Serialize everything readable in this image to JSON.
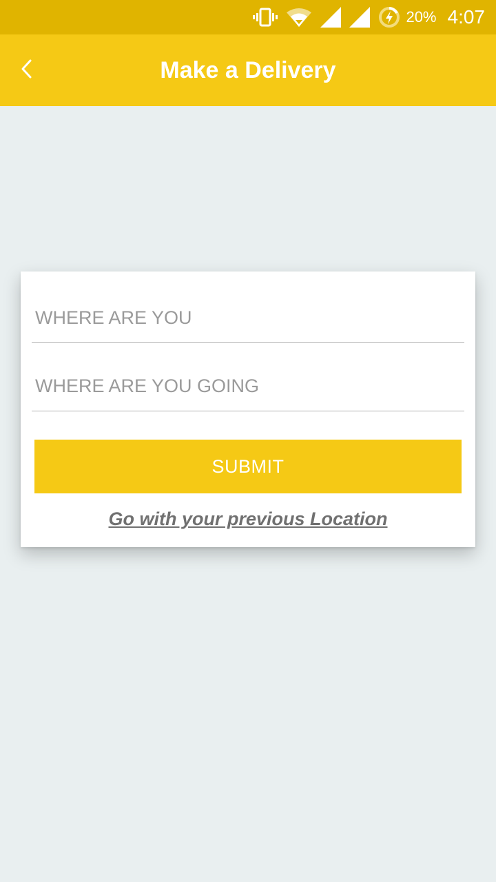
{
  "status_bar": {
    "icons": [
      "vibrate-icon",
      "wifi-icon",
      "cell-signal-icon",
      "cell-signal-icon",
      "battery-charging-icon"
    ],
    "battery": "20%",
    "time": "4:07"
  },
  "app_bar": {
    "back_icon": "chevron-left-icon",
    "title": "Make a Delivery",
    "background": "#f5c915"
  },
  "form": {
    "from_placeholder": "WHERE ARE YOU",
    "from_value": "",
    "to_placeholder": "WHERE ARE YOU GOING",
    "to_value": "",
    "submit_label": "SUBMIT",
    "previous_location_link": "Go with your previous Location"
  },
  "colors": {
    "status_bar": "#e0b400",
    "accent": "#f5c915",
    "background": "#e9eff0",
    "link": "#707070"
  }
}
